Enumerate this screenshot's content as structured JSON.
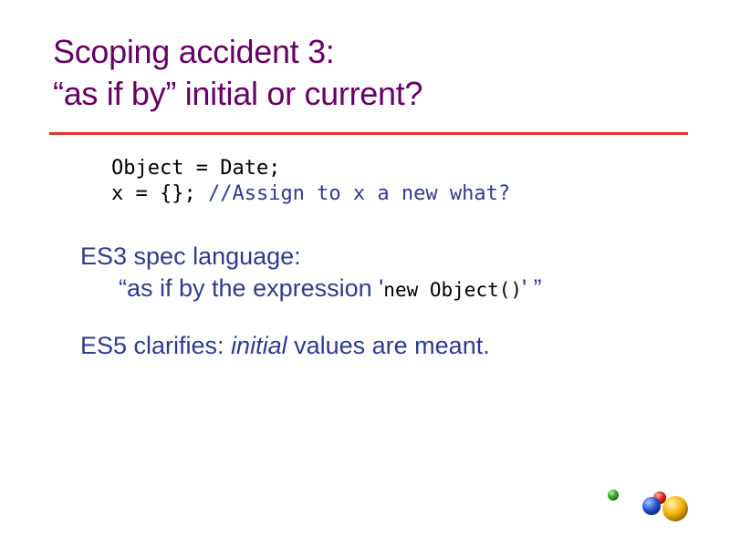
{
  "slide": {
    "title_line1": "Scoping accident 3:",
    "title_line2": "“as if by” initial or current?",
    "code_line1": "Object = Date;",
    "code_line2_code": "x = {}; ",
    "code_line2_comment": "//Assign to x a new what?",
    "es3_heading": "ES3 spec language:",
    "es3_quote_open": "“as if by the expression '",
    "es3_quote_code": "new Object()",
    "es3_quote_close": "' ”",
    "es5_prefix": "ES5 clarifies: ",
    "es5_emphasis": "initial",
    "es5_suffix": " values are meant."
  },
  "colors": {
    "title": "#660066",
    "divider": "#d93a2b",
    "body": "#2e3b8f",
    "code": "#000000"
  },
  "logo": {
    "icon": "colored-balls-logo-icon",
    "balls": [
      "green",
      "red",
      "blue",
      "yellow"
    ]
  }
}
